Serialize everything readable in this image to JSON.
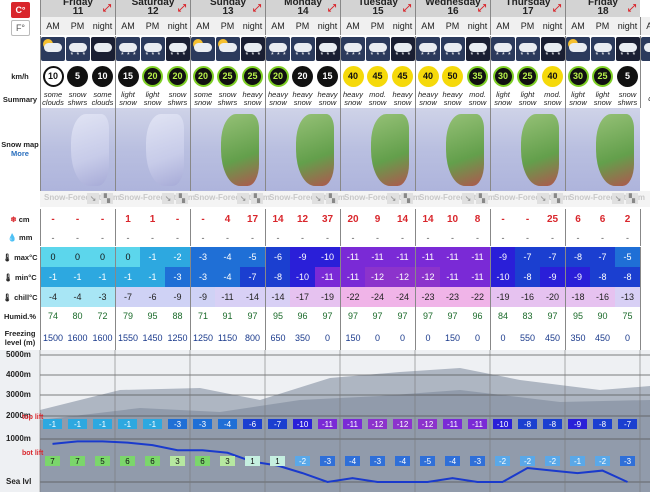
{
  "units": {
    "celsius": "C°",
    "fahrenheit": "F°"
  },
  "labels": {
    "wind": "km/h",
    "summary": "Summary",
    "snow_map": "Snow map",
    "snow_map_more": "More",
    "snow": "cm",
    "rain": "mm",
    "max": "max°C",
    "min": "min°C",
    "chill": "chill°C",
    "humid": "Humid.%",
    "freezing": "Freezing level (m)"
  },
  "days": [
    {
      "name": "Friday",
      "num": "11"
    },
    {
      "name": "Saturday",
      "num": "12"
    },
    {
      "name": "Sunday",
      "num": "13"
    },
    {
      "name": "Monday",
      "num": "14"
    },
    {
      "name": "Tuesday",
      "num": "15"
    },
    {
      "name": "Wednesday",
      "num": "16"
    },
    {
      "name": "Thursday",
      "num": "17"
    },
    {
      "name": "Friday",
      "num": "18"
    }
  ],
  "periods": [
    "AM",
    "PM",
    "night"
  ],
  "weather_icons": [
    "partly-cloudy",
    "snow-shower",
    "cloudy-night",
    "light-snow",
    "light-snow",
    "snow-night",
    "partly-cloudy",
    "partly-cloudy",
    "snow-night",
    "heavy-snow",
    "heavy-snow",
    "heavy-snow",
    "heavy-snow",
    "heavy-snow",
    "heavy-snow",
    "heavy-snow",
    "heavy-snow",
    "heavy-snow",
    "light-snow",
    "light-snow",
    "heavy-snow",
    "partly-cloudy",
    "light-snow",
    "snow-night",
    "cloud"
  ],
  "wind": [
    {
      "v": "10",
      "s": "light"
    },
    {
      "v": "5",
      "s": "dark"
    },
    {
      "v": "10",
      "s": "dark"
    },
    {
      "v": "15",
      "s": "dark"
    },
    {
      "v": "20",
      "s": "lime"
    },
    {
      "v": "20",
      "s": "lime"
    },
    {
      "v": "20",
      "s": "lime"
    },
    {
      "v": "25",
      "s": "lime"
    },
    {
      "v": "25",
      "s": "lime"
    },
    {
      "v": "20",
      "s": "lime"
    },
    {
      "v": "20",
      "s": "dark"
    },
    {
      "v": "15",
      "s": "dark"
    },
    {
      "v": "40",
      "s": "yellow"
    },
    {
      "v": "45",
      "s": "yellow"
    },
    {
      "v": "45",
      "s": "yellow"
    },
    {
      "v": "40",
      "s": "yellow"
    },
    {
      "v": "50",
      "s": "yellow"
    },
    {
      "v": "35",
      "s": "lime"
    },
    {
      "v": "30",
      "s": "lime"
    },
    {
      "v": "25",
      "s": "lime"
    },
    {
      "v": "40",
      "s": "yellow"
    },
    {
      "v": "30",
      "s": "lime"
    },
    {
      "v": "25",
      "s": "lime"
    },
    {
      "v": "5",
      "s": "dark"
    },
    {
      "v": "",
      "s": "none"
    }
  ],
  "summary": [
    [
      "some",
      "clouds"
    ],
    [
      "snow",
      "shwrs"
    ],
    [
      "some",
      "clouds"
    ],
    [
      "light",
      "snow"
    ],
    [
      "light",
      "snow"
    ],
    [
      "snow",
      "shwrs"
    ],
    [
      "some",
      "snow"
    ],
    [
      "snow",
      "shwrs"
    ],
    [
      "heavy",
      "snow"
    ],
    [
      "heavy",
      "snow"
    ],
    [
      "heavy",
      "snow"
    ],
    [
      "heavy",
      "snow"
    ],
    [
      "heavy",
      "snow"
    ],
    [
      "mod.",
      "snow"
    ],
    [
      "heavy",
      "snow"
    ],
    [
      "heavy",
      "snow"
    ],
    [
      "heavy",
      "snow"
    ],
    [
      "mod.",
      "snow"
    ],
    [
      "light",
      "snow"
    ],
    [
      "light",
      "snow"
    ],
    [
      "mod.",
      "snow"
    ],
    [
      "light",
      "snow"
    ],
    [
      "light",
      "snow"
    ],
    [
      "snow",
      "shwrs"
    ],
    [
      "clo",
      ""
    ]
  ],
  "credit": "Snow-Forecast.com",
  "snow_cm": [
    "-",
    "-",
    "-",
    "1",
    "1",
    "-",
    "-",
    "4",
    "17",
    "14",
    "12",
    "37",
    "20",
    "9",
    "14",
    "14",
    "10",
    "8",
    "-",
    "-",
    "25",
    "6",
    "6",
    "2",
    "-"
  ],
  "rain_mm": [
    "-",
    "-",
    "-",
    "-",
    "-",
    "-",
    "-",
    "-",
    "-",
    "-",
    "-",
    "-",
    "-",
    "-",
    "-",
    "-",
    "-",
    "-",
    "-",
    "-",
    "-",
    "-",
    "-",
    "-",
    "-"
  ],
  "max_c": [
    "0",
    "0",
    "0",
    "0",
    "-1",
    "-2",
    "-3",
    "-4",
    "-5",
    "-6",
    "-9",
    "-10",
    "-11",
    "-11",
    "-11",
    "-11",
    "-11",
    "-11",
    "-9",
    "-7",
    "-7",
    "-8",
    "-7",
    "-5",
    ""
  ],
  "min_c": [
    "-1",
    "-1",
    "-1",
    "-1",
    "-1",
    "-3",
    "-3",
    "-4",
    "-7",
    "-8",
    "-10",
    "-11",
    "-11",
    "-12",
    "-12",
    "-12",
    "-11",
    "-11",
    "-10",
    "-8",
    "-9",
    "-9",
    "-8",
    "-8",
    ""
  ],
  "chill_c": [
    "-4",
    "-4",
    "-3",
    "-7",
    "-6",
    "-9",
    "-9",
    "-11",
    "-14",
    "-14",
    "-17",
    "-19",
    "-22",
    "-24",
    "-24",
    "-23",
    "-23",
    "-22",
    "-19",
    "-16",
    "-20",
    "-18",
    "-16",
    "-13",
    ""
  ],
  "humid": [
    "74",
    "80",
    "72",
    "79",
    "95",
    "88",
    "71",
    "91",
    "97",
    "95",
    "96",
    "97",
    "97",
    "97",
    "97",
    "97",
    "97",
    "96",
    "84",
    "83",
    "97",
    "95",
    "90",
    "75",
    ""
  ],
  "freezing": [
    "1500",
    "1600",
    "1600",
    "1550",
    "1450",
    "1250",
    "1250",
    "1150",
    "800",
    "650",
    "350",
    "0",
    "150",
    "0",
    "0",
    "0",
    "150",
    "0",
    "0",
    "550",
    "450",
    "350",
    "450",
    "0",
    ""
  ],
  "altitudes": [
    "5000m",
    "4000m",
    "3000m",
    "2000m",
    "1000m",
    "Sea lvl"
  ],
  "lift": {
    "top": "top lift",
    "bot": "bot lift"
  },
  "top_lift_temps": [
    "-1",
    "-1",
    "-1",
    "-1",
    "-1",
    "-3",
    "-3",
    "-4",
    "-6",
    "-7",
    "-10",
    "-11",
    "-11",
    "-12",
    "-12",
    "-12",
    "-11",
    "-11",
    "-10",
    "-8",
    "-8",
    "-9",
    "-8",
    "-7",
    ""
  ],
  "bot_lift_temps": [
    "7",
    "7",
    "5",
    "6",
    "6",
    "3",
    "6",
    "3",
    "1",
    "1",
    "-2",
    "-3",
    "-4",
    "-3",
    "-4",
    "-5",
    "-4",
    "-3",
    "-2",
    "-2",
    "-2",
    "-1",
    "-2",
    "-3",
    ""
  ],
  "colors": {
    "accent": "#d9262c",
    "day_header": "#d3d3d3",
    "snow_red": "#d9262c",
    "freeze_line": "#1a3acc"
  }
}
